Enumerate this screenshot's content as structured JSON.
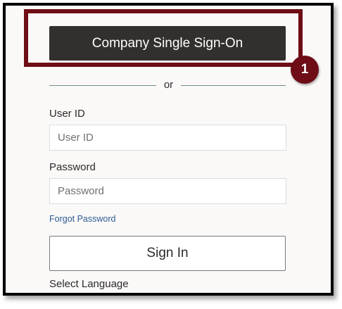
{
  "sso": {
    "label": "Company Single Sign-On"
  },
  "callout": {
    "number": "1"
  },
  "divider": {
    "text": "or"
  },
  "user_id": {
    "label": "User ID",
    "placeholder": "User ID",
    "value": ""
  },
  "password": {
    "label": "Password",
    "placeholder": "Password",
    "value": ""
  },
  "forgot_password": {
    "label": "Forgot Password"
  },
  "sign_in": {
    "label": "Sign In"
  },
  "language": {
    "label": "Select Language"
  },
  "colors": {
    "sso_button": "#322f2d",
    "highlight": "#6e0d15",
    "link": "#2a5b94",
    "divider": "#6f8f8c",
    "panel_bg": "#fbf9f8"
  }
}
